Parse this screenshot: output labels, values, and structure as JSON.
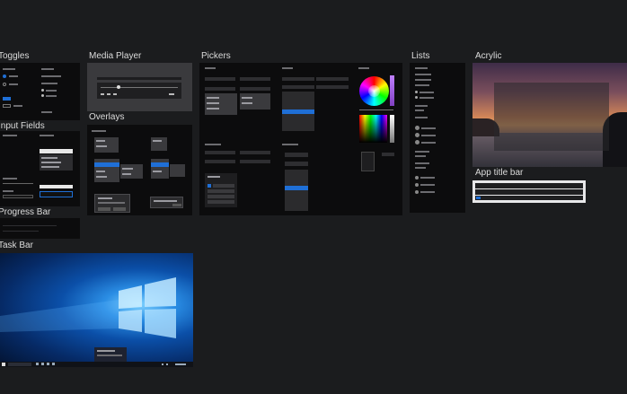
{
  "canvas": {
    "background": "#1b1c1e"
  },
  "artboards": {
    "toggles": {
      "title": "Toggles"
    },
    "media_player": {
      "title": "Media Player"
    },
    "pickers": {
      "title": "Pickers"
    },
    "lists": {
      "title": "Lists"
    },
    "acrylic": {
      "title": "Acrylic"
    },
    "overlays": {
      "title": "Overlays"
    },
    "input_fields": {
      "title": "Input Fields"
    },
    "app_title_bar": {
      "title": "App title bar"
    },
    "progress_bar": {
      "title": "Progress Bar"
    },
    "task_bar": {
      "title": "Task Bar"
    }
  },
  "colors": {
    "accent": "#1f6fd6",
    "artboard_bg": "#0c0c0d",
    "control_bg": "#2b2b2d"
  },
  "icons": [
    "windows-logo-icon",
    "color-wheel-icon",
    "calendar-icon",
    "play-icon"
  ]
}
